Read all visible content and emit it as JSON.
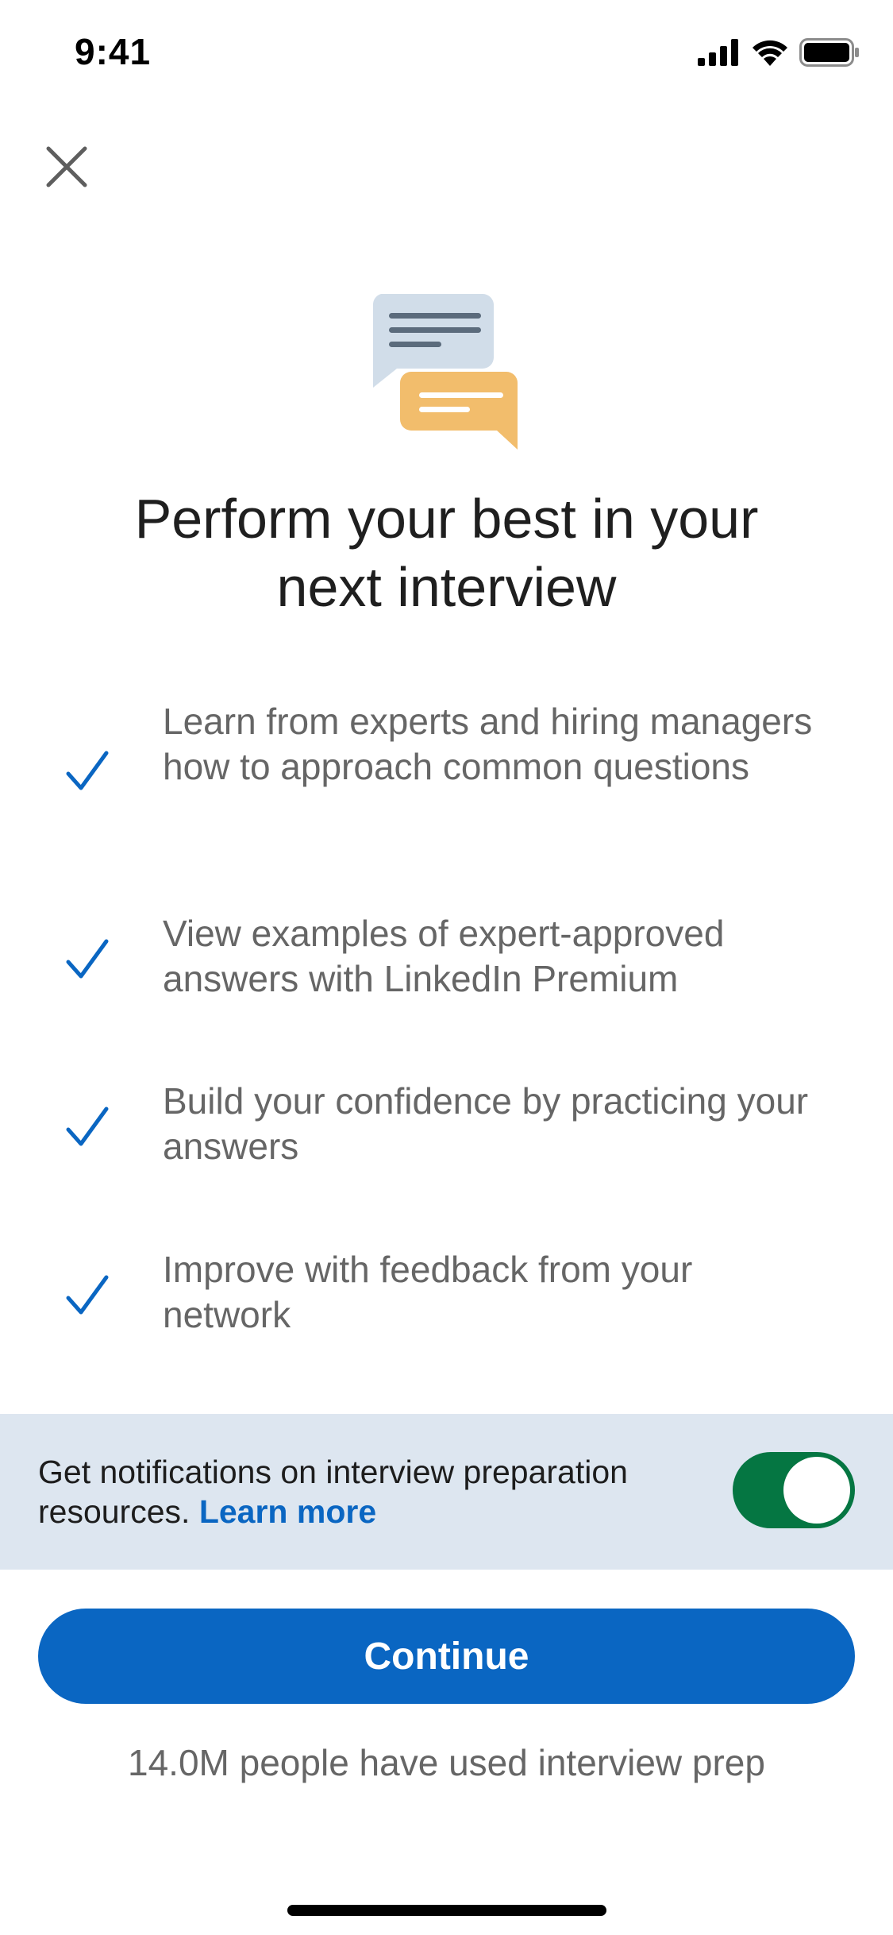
{
  "status_bar": {
    "time": "9:41",
    "icons": [
      "cellular-signal-icon",
      "wifi-icon",
      "battery-icon"
    ]
  },
  "header": {
    "close_icon": "close-icon"
  },
  "hero": {
    "illustration": "chat-bubbles-icon",
    "title": "Perform your best in your next interview"
  },
  "benefits": [
    {
      "icon": "checkmark-icon",
      "text": "Learn from experts and hiring managers how to approach common questions"
    },
    {
      "icon": "checkmark-icon",
      "text": "View examples of expert-approved answers with LinkedIn Premium"
    },
    {
      "icon": "checkmark-icon",
      "text": "Build your confidence by practicing your answers"
    },
    {
      "icon": "checkmark-icon",
      "text": "Improve with feedback from your network"
    }
  ],
  "notifications": {
    "text": "Get notifications on interview preparation resources.",
    "link": "Learn more",
    "toggle_on": true
  },
  "actions": {
    "continue_label": "Continue"
  },
  "footer": {
    "usage_text": "14.0M people have used interview prep"
  },
  "colors": {
    "primary": "#0a66c2",
    "toggle_on": "#057642",
    "notif_bg": "#dde6f0",
    "body_text": "#666666"
  }
}
